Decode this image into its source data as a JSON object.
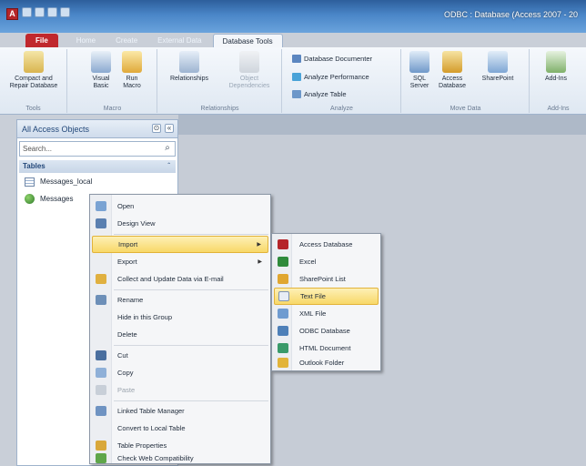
{
  "window": {
    "title": "ODBC : Database (Access 2007 - 20"
  },
  "tabs": [
    "File",
    "Home",
    "Create",
    "External Data",
    "Database Tools"
  ],
  "ribbon": {
    "groups": [
      {
        "label": "Tools",
        "buttons": [
          "Compact and\nRepair Database"
        ]
      },
      {
        "label": "Macro",
        "buttons": [
          "Visual\nBasic",
          "Run\nMacro"
        ]
      },
      {
        "label": "Relationships",
        "buttons": [
          "Relationships",
          "Object\nDependencies"
        ]
      },
      {
        "label": "Analyze",
        "buttons": [
          "Database Documenter",
          "Analyze Performance",
          "Analyze Table"
        ]
      },
      {
        "label": "Move Data",
        "buttons": [
          "SQL\nServer",
          "Access\nDatabase",
          "SharePoint"
        ]
      },
      {
        "label": "Add-Ins",
        "buttons": [
          "Add-Ins"
        ]
      }
    ]
  },
  "nav": {
    "title": "All Access Objects",
    "search_placeholder": "Search...",
    "section": "Tables",
    "items": [
      "Messages_local",
      "Messages"
    ]
  },
  "context_menu": {
    "items": [
      "Open",
      "Design View",
      "Import",
      "Export",
      "Collect and Update Data via E-mail",
      "Rename",
      "Hide in this Group",
      "Delete",
      "Cut",
      "Copy",
      "Paste",
      "Linked Table Manager",
      "Convert to Local Table",
      "Table Properties",
      "Check Web Compatibility"
    ],
    "highlighted": "Import"
  },
  "submenu": {
    "items": [
      "Access Database",
      "Excel",
      "SharePoint List",
      "Text File",
      "XML File",
      "ODBC Database",
      "HTML Document",
      "Outlook Folder"
    ],
    "highlighted": "Text File"
  },
  "colors": {
    "title_bar": "#4a86c8",
    "file_tab": "#c0282d",
    "highlight": "#f8d868"
  }
}
